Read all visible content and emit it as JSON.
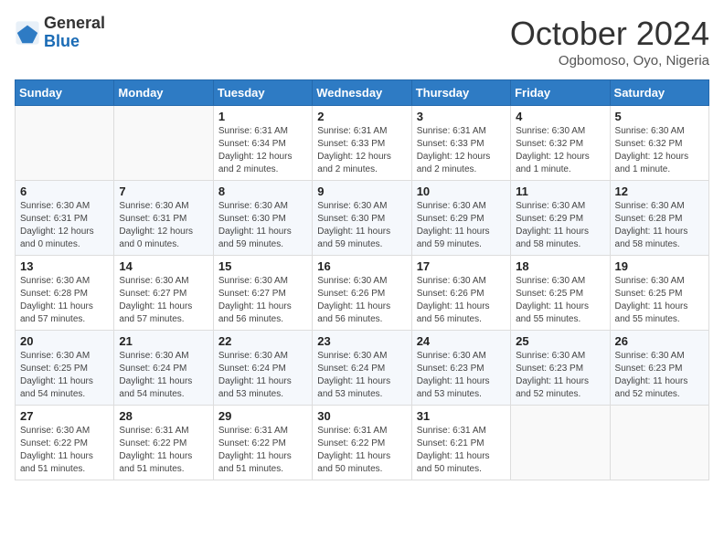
{
  "header": {
    "logo_general": "General",
    "logo_blue": "Blue",
    "month": "October 2024",
    "location": "Ogbomoso, Oyo, Nigeria"
  },
  "weekdays": [
    "Sunday",
    "Monday",
    "Tuesday",
    "Wednesday",
    "Thursday",
    "Friday",
    "Saturday"
  ],
  "weeks": [
    [
      {
        "day": "",
        "info": ""
      },
      {
        "day": "",
        "info": ""
      },
      {
        "day": "1",
        "info": "Sunrise: 6:31 AM\nSunset: 6:34 PM\nDaylight: 12 hours and 2 minutes."
      },
      {
        "day": "2",
        "info": "Sunrise: 6:31 AM\nSunset: 6:33 PM\nDaylight: 12 hours and 2 minutes."
      },
      {
        "day": "3",
        "info": "Sunrise: 6:31 AM\nSunset: 6:33 PM\nDaylight: 12 hours and 2 minutes."
      },
      {
        "day": "4",
        "info": "Sunrise: 6:30 AM\nSunset: 6:32 PM\nDaylight: 12 hours and 1 minute."
      },
      {
        "day": "5",
        "info": "Sunrise: 6:30 AM\nSunset: 6:32 PM\nDaylight: 12 hours and 1 minute."
      }
    ],
    [
      {
        "day": "6",
        "info": "Sunrise: 6:30 AM\nSunset: 6:31 PM\nDaylight: 12 hours and 0 minutes."
      },
      {
        "day": "7",
        "info": "Sunrise: 6:30 AM\nSunset: 6:31 PM\nDaylight: 12 hours and 0 minutes."
      },
      {
        "day": "8",
        "info": "Sunrise: 6:30 AM\nSunset: 6:30 PM\nDaylight: 11 hours and 59 minutes."
      },
      {
        "day": "9",
        "info": "Sunrise: 6:30 AM\nSunset: 6:30 PM\nDaylight: 11 hours and 59 minutes."
      },
      {
        "day": "10",
        "info": "Sunrise: 6:30 AM\nSunset: 6:29 PM\nDaylight: 11 hours and 59 minutes."
      },
      {
        "day": "11",
        "info": "Sunrise: 6:30 AM\nSunset: 6:29 PM\nDaylight: 11 hours and 58 minutes."
      },
      {
        "day": "12",
        "info": "Sunrise: 6:30 AM\nSunset: 6:28 PM\nDaylight: 11 hours and 58 minutes."
      }
    ],
    [
      {
        "day": "13",
        "info": "Sunrise: 6:30 AM\nSunset: 6:28 PM\nDaylight: 11 hours and 57 minutes."
      },
      {
        "day": "14",
        "info": "Sunrise: 6:30 AM\nSunset: 6:27 PM\nDaylight: 11 hours and 57 minutes."
      },
      {
        "day": "15",
        "info": "Sunrise: 6:30 AM\nSunset: 6:27 PM\nDaylight: 11 hours and 56 minutes."
      },
      {
        "day": "16",
        "info": "Sunrise: 6:30 AM\nSunset: 6:26 PM\nDaylight: 11 hours and 56 minutes."
      },
      {
        "day": "17",
        "info": "Sunrise: 6:30 AM\nSunset: 6:26 PM\nDaylight: 11 hours and 56 minutes."
      },
      {
        "day": "18",
        "info": "Sunrise: 6:30 AM\nSunset: 6:25 PM\nDaylight: 11 hours and 55 minutes."
      },
      {
        "day": "19",
        "info": "Sunrise: 6:30 AM\nSunset: 6:25 PM\nDaylight: 11 hours and 55 minutes."
      }
    ],
    [
      {
        "day": "20",
        "info": "Sunrise: 6:30 AM\nSunset: 6:25 PM\nDaylight: 11 hours and 54 minutes."
      },
      {
        "day": "21",
        "info": "Sunrise: 6:30 AM\nSunset: 6:24 PM\nDaylight: 11 hours and 54 minutes."
      },
      {
        "day": "22",
        "info": "Sunrise: 6:30 AM\nSunset: 6:24 PM\nDaylight: 11 hours and 53 minutes."
      },
      {
        "day": "23",
        "info": "Sunrise: 6:30 AM\nSunset: 6:24 PM\nDaylight: 11 hours and 53 minutes."
      },
      {
        "day": "24",
        "info": "Sunrise: 6:30 AM\nSunset: 6:23 PM\nDaylight: 11 hours and 53 minutes."
      },
      {
        "day": "25",
        "info": "Sunrise: 6:30 AM\nSunset: 6:23 PM\nDaylight: 11 hours and 52 minutes."
      },
      {
        "day": "26",
        "info": "Sunrise: 6:30 AM\nSunset: 6:23 PM\nDaylight: 11 hours and 52 minutes."
      }
    ],
    [
      {
        "day": "27",
        "info": "Sunrise: 6:30 AM\nSunset: 6:22 PM\nDaylight: 11 hours and 51 minutes."
      },
      {
        "day": "28",
        "info": "Sunrise: 6:31 AM\nSunset: 6:22 PM\nDaylight: 11 hours and 51 minutes."
      },
      {
        "day": "29",
        "info": "Sunrise: 6:31 AM\nSunset: 6:22 PM\nDaylight: 11 hours and 51 minutes."
      },
      {
        "day": "30",
        "info": "Sunrise: 6:31 AM\nSunset: 6:22 PM\nDaylight: 11 hours and 50 minutes."
      },
      {
        "day": "31",
        "info": "Sunrise: 6:31 AM\nSunset: 6:21 PM\nDaylight: 11 hours and 50 minutes."
      },
      {
        "day": "",
        "info": ""
      },
      {
        "day": "",
        "info": ""
      }
    ]
  ]
}
